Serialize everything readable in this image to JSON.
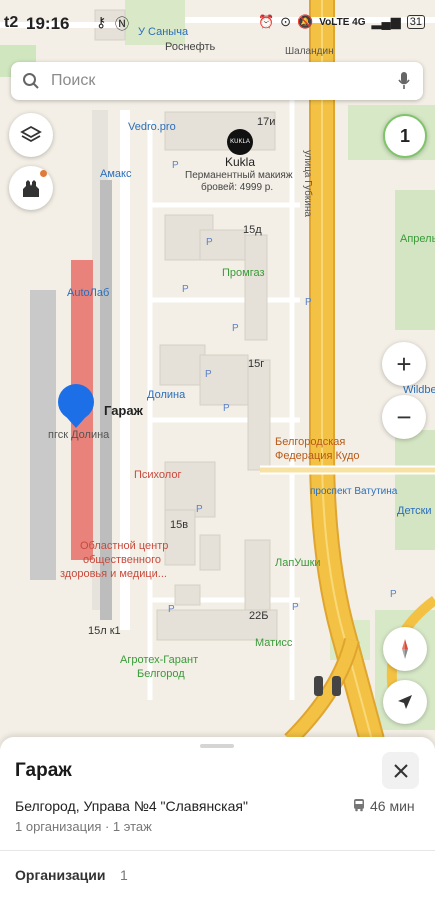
{
  "status_bar": {
    "time": "19:16",
    "carrier_icon": "t2",
    "network": "VoLTE 4G",
    "battery": "31"
  },
  "search": {
    "placeholder": "Поиск",
    "icons": [
      "search-icon",
      "mic-icon"
    ]
  },
  "controls": {
    "notification_count": "1",
    "layers_icon": "layers-icon",
    "landmark_icon": "kremlin-icon",
    "zoom_in": "+",
    "zoom_out": "−",
    "compass_icon": "compass-icon",
    "locate_icon": "navigation-arrow-icon"
  },
  "map": {
    "streets": {
      "gubkina": "улица Губкина",
      "vatutina": "проспект Ватутина"
    },
    "places": {
      "u_sanycha": "У Саныча",
      "rosneft": "Роснефть",
      "shalandin": "Шаландин",
      "vedro": "Vedro.pro",
      "amaks": "Амакс",
      "kukla_logo": "KUKLA",
      "kukla": "Kukla",
      "kukla_sub1": "Перманентный макияж",
      "kukla_sub2": "бровей: 4999 р.",
      "b17i": "17и",
      "b15d": "15д",
      "promgaz": "Промгаз",
      "aprel": "Апрель",
      "autolab": "AutoЛаб",
      "b15g": "15г",
      "dolina": "Долина",
      "wildber": "Wildber",
      "garage": "Гараж",
      "pgsk": "пгск Долина",
      "belgorod_fed_1": "Белгородская",
      "belgorod_fed_2": "Федерация Кудо",
      "psiholog": "Психолог",
      "detski": "Детски",
      "b15v": "15в",
      "center_1": "Областной центр",
      "center_2": "общественного",
      "center_3": "здоровья и медици...",
      "lapushki": "ЛапУшки",
      "b22b": "22Б",
      "b15l": "15л к1",
      "matiss": "Матисс",
      "agroteh_1": "Агротех-Гарант",
      "agroteh_2": "Белгород"
    },
    "colors": {
      "background": "#f3efe6",
      "road_yellow": "#f3c244",
      "road_edge": "#e0a52f",
      "route": "#e8827a",
      "marker": "#1d6fe8",
      "poi_green": "#3a9a3a",
      "poi_red": "#c84a3c",
      "poi_blue": "#2a6ebb"
    }
  },
  "sheet": {
    "title": "Гараж",
    "address": "Белгород, Управа №4 \"Славянская\"",
    "transit_time": "46 мин",
    "details": "1 организация · 1 этаж",
    "section_label": "Организации",
    "section_count": "1"
  }
}
